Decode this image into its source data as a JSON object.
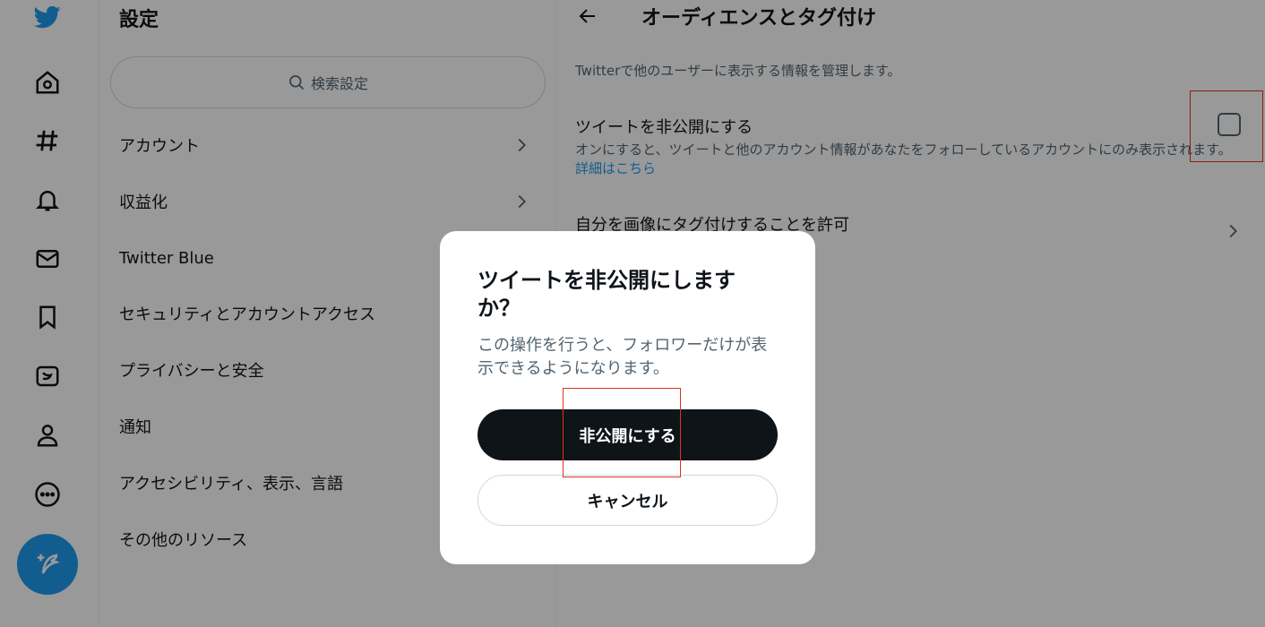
{
  "rail": {
    "items": [
      "twitter-logo-icon",
      "home-icon",
      "explore-hashtag-icon",
      "notifications-bell-icon",
      "messages-mail-icon",
      "bookmarks-icon",
      "twitter-blue-icon",
      "profile-icon",
      "more-icon",
      "compose-tweet-icon"
    ]
  },
  "settings": {
    "title": "設定",
    "search_placeholder": "検索設定",
    "items": [
      {
        "label": "アカウント"
      },
      {
        "label": "収益化"
      },
      {
        "label": "Twitter Blue"
      },
      {
        "label": "セキュリティとアカウントアクセス"
      },
      {
        "label": "プライバシーと安全"
      },
      {
        "label": "通知"
      },
      {
        "label": "アクセシビリティ、表示、言語"
      },
      {
        "label": "その他のリソース"
      }
    ]
  },
  "detail": {
    "title": "オーディエンスとタグ付け",
    "description": "Twitterで他のユーザーに表示する情報を管理します。",
    "protect": {
      "title": "ツイートを非公開にする",
      "description": "オンにすると、ツイートと他のアカウント情報があなたをフォローしているアカウントにのみ表示されます。",
      "link": "詳細はこちら",
      "checked": false
    },
    "photo_tagging": {
      "label": "自分を画像にタグ付けすることを許可"
    }
  },
  "modal": {
    "title": "ツイートを非公開にしますか？",
    "text": "この操作を行うと、フォロワーだけが表示できるようになります。",
    "confirm_label": "非公開にする",
    "cancel_label": "キャンセル"
  },
  "colors": {
    "accent": "#1d9bf0",
    "text": "#0f1419",
    "secondary_text": "#536471",
    "annotation": "#e0321e"
  }
}
